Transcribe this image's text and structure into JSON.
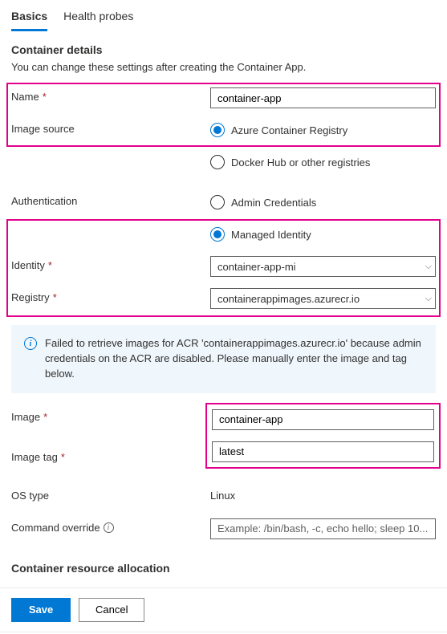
{
  "tabs": {
    "basics": "Basics",
    "health_probes": "Health probes"
  },
  "container_details": {
    "title": "Container details",
    "desc": "You can change these settings after creating the Container App.",
    "name_label": "Name",
    "name_value": "container-app",
    "image_source_label": "Image source",
    "image_source_acr": "Azure Container Registry",
    "image_source_docker": "Docker Hub or other registries",
    "auth_label": "Authentication",
    "auth_admin": "Admin Credentials",
    "auth_managed": "Managed Identity",
    "identity_label": "Identity",
    "identity_value": "container-app-mi",
    "registry_label": "Registry",
    "registry_value": "containerappimages.azurecr.io",
    "info_message": "Failed to retrieve images for ACR 'containerappimages.azurecr.io' because admin credentials on the ACR are disabled. Please manually enter the image and tag below.",
    "image_label": "Image",
    "image_value": "container-app",
    "image_tag_label": "Image tag",
    "image_tag_value": "latest",
    "os_type_label": "OS type",
    "os_type_value": "Linux",
    "command_override_label": "Command override",
    "command_override_placeholder": "Example: /bin/bash, -c, echo hello; sleep 10..."
  },
  "resource_allocation": {
    "title": "Container resource allocation"
  },
  "footer": {
    "save": "Save",
    "cancel": "Cancel"
  },
  "required_marker": "*"
}
